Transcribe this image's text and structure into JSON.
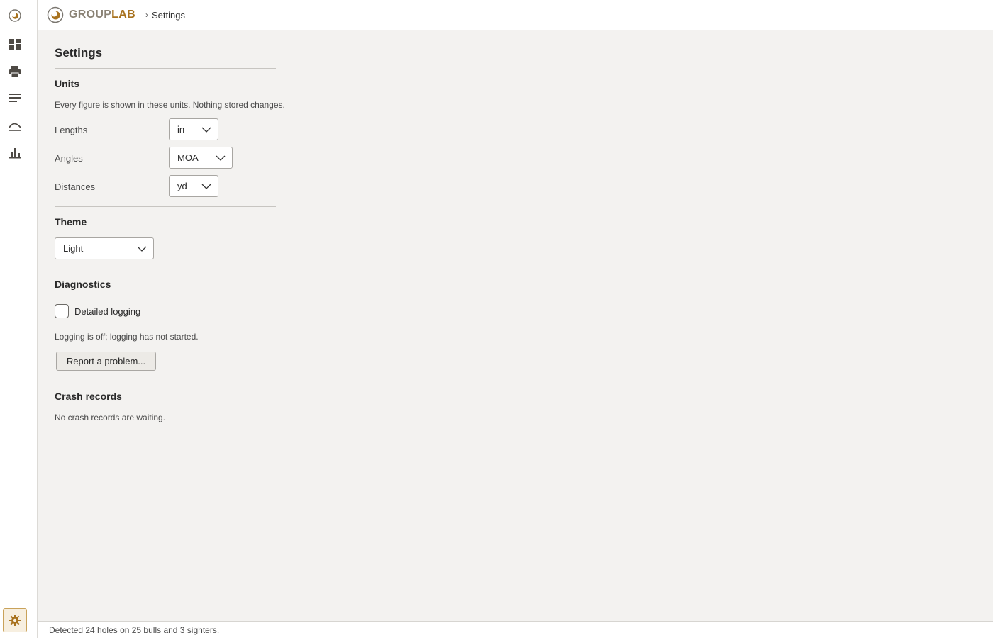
{
  "app": {
    "brand_part1": "GROUP",
    "brand_part2": "LAB",
    "breadcrumb_separator": "›",
    "breadcrumb_current": "Settings"
  },
  "rail": {
    "items": [
      {
        "icon": "logo-target-icon"
      },
      {
        "icon": "dashboard-grid-icon"
      },
      {
        "icon": "printer-icon"
      },
      {
        "icon": "list-lines-icon"
      },
      {
        "icon": "trajectory-arc-icon"
      },
      {
        "icon": "bar-chart-icon"
      }
    ],
    "settings_icon": "gear-icon"
  },
  "settings": {
    "title": "Settings",
    "units": {
      "title": "Units",
      "help": "Every figure is shown in these units. Nothing stored changes.",
      "lengths_label": "Lengths",
      "lengths_value": "in",
      "angles_label": "Angles",
      "angles_value": "MOA",
      "distances_label": "Distances",
      "distances_value": "yd"
    },
    "theme": {
      "title": "Theme",
      "value": "Light"
    },
    "diagnostics": {
      "title": "Diagnostics",
      "logging_label": "Detailed logging",
      "logging_checked": false,
      "logging_status": "Logging is off; logging has not started.",
      "report_button": "Report a problem..."
    },
    "crash": {
      "title": "Crash records",
      "status": "No crash records are waiting."
    }
  },
  "status": {
    "text": "Detected 24 holes on 25 bulls and 3 sighters."
  },
  "colors": {
    "accent": "#a8721e",
    "background": "#f3f2f0",
    "brand_gray": "#8a8275"
  }
}
